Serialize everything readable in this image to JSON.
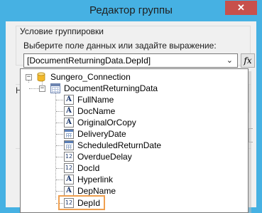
{
  "window": {
    "title": "Редактор группы",
    "close_glyph": "✕"
  },
  "group": {
    "title": "Условие группировки",
    "prompt": "Выберите поле данных или задайте выражение:"
  },
  "combo": {
    "value": "[DocumentReturningData.DepId]",
    "arrow": "⌄"
  },
  "fx_button": {
    "label": "fx"
  },
  "background": {
    "partial_label": "Н"
  },
  "tree": {
    "connection": {
      "label": "Sungero_Connection",
      "toggle": "−",
      "icon": "database-icon"
    },
    "table": {
      "label": "DocumentReturningData",
      "toggle": "−",
      "icon": "table-icon"
    },
    "fields": [
      {
        "label": "FullName",
        "icon": "text-field-icon",
        "glyph": "A"
      },
      {
        "label": "DocName",
        "icon": "text-field-icon",
        "glyph": "A"
      },
      {
        "label": "OriginalOrCopy",
        "icon": "text-field-icon",
        "glyph": "A"
      },
      {
        "label": "DeliveryDate",
        "icon": "date-field-icon",
        "glyph": ""
      },
      {
        "label": "ScheduledReturnDate",
        "icon": "date-field-icon",
        "glyph": ""
      },
      {
        "label": "OverdueDelay",
        "icon": "number-field-icon",
        "glyph": "12"
      },
      {
        "label": "DocId",
        "icon": "number-field-icon",
        "glyph": "12"
      },
      {
        "label": "Hyperlink",
        "icon": "text-field-icon",
        "glyph": "A"
      },
      {
        "label": "DepName",
        "icon": "text-field-icon",
        "glyph": "A"
      },
      {
        "label": "DepId",
        "icon": "number-field-icon",
        "glyph": "12"
      }
    ],
    "selected": "DepId"
  },
  "colors": {
    "title_bar": "#46b1e3",
    "close_button": "#c7504c",
    "selection_border": "#f0a050"
  }
}
